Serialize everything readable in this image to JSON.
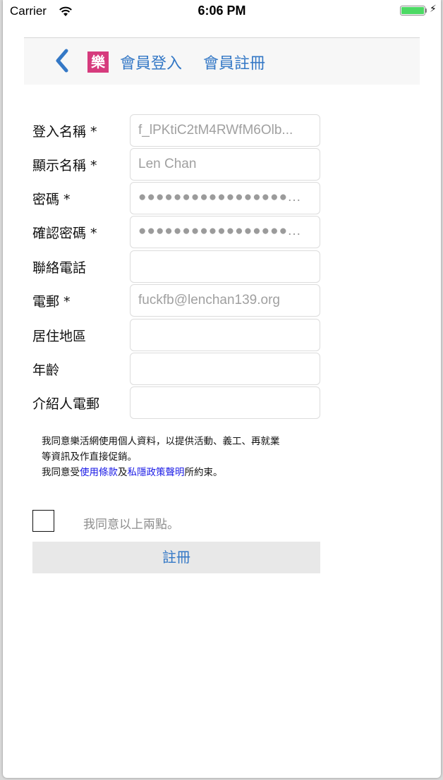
{
  "status_bar": {
    "carrier": "Carrier",
    "time": "6:06 PM",
    "battery_level": 1.0,
    "icons": [
      "wifi-icon",
      "battery-icon",
      "charging-bolt-icon"
    ]
  },
  "nav": {
    "back_icon": "chevron-left-icon",
    "logo_text": "樂",
    "login_label": "會員登入",
    "register_label": "會員註冊",
    "accent_color": "#3478c6",
    "logo_color": "#d63b7d"
  },
  "form": {
    "fields": [
      {
        "label": "登入名稱 *",
        "value": "f_lPKtiC2tM4RWfM6Olb..."
      },
      {
        "label": "顯示名稱 *",
        "value": "Len Chan"
      },
      {
        "label": "密碼 *",
        "value": "●●●●●●●●●●●●●●●●●..."
      },
      {
        "label": "確認密碼 *",
        "value": "●●●●●●●●●●●●●●●●●..."
      },
      {
        "label": "聯絡電話",
        "value": ""
      },
      {
        "label": "電郵 *",
        "value": "fuckfb@lenchan139.org"
      },
      {
        "label": "居住地區",
        "value": ""
      },
      {
        "label": "年齡",
        "value": ""
      },
      {
        "label": "介紹人電郵",
        "value": ""
      }
    ]
  },
  "consent": {
    "line1": "我同意樂活網使用個人資料，以提供活動、義工、再就業",
    "line2": "等資訊及作直接促銷。",
    "line3_prefix": "我同意受",
    "terms_link": "使用條款",
    "and": "及",
    "privacy_link": "私隱政策聲明",
    "line3_suffix": "所約束。",
    "link_color": "#1a1ae6"
  },
  "agree": {
    "checked": false,
    "label": "我同意以上兩點。"
  },
  "submit_label": "註冊"
}
